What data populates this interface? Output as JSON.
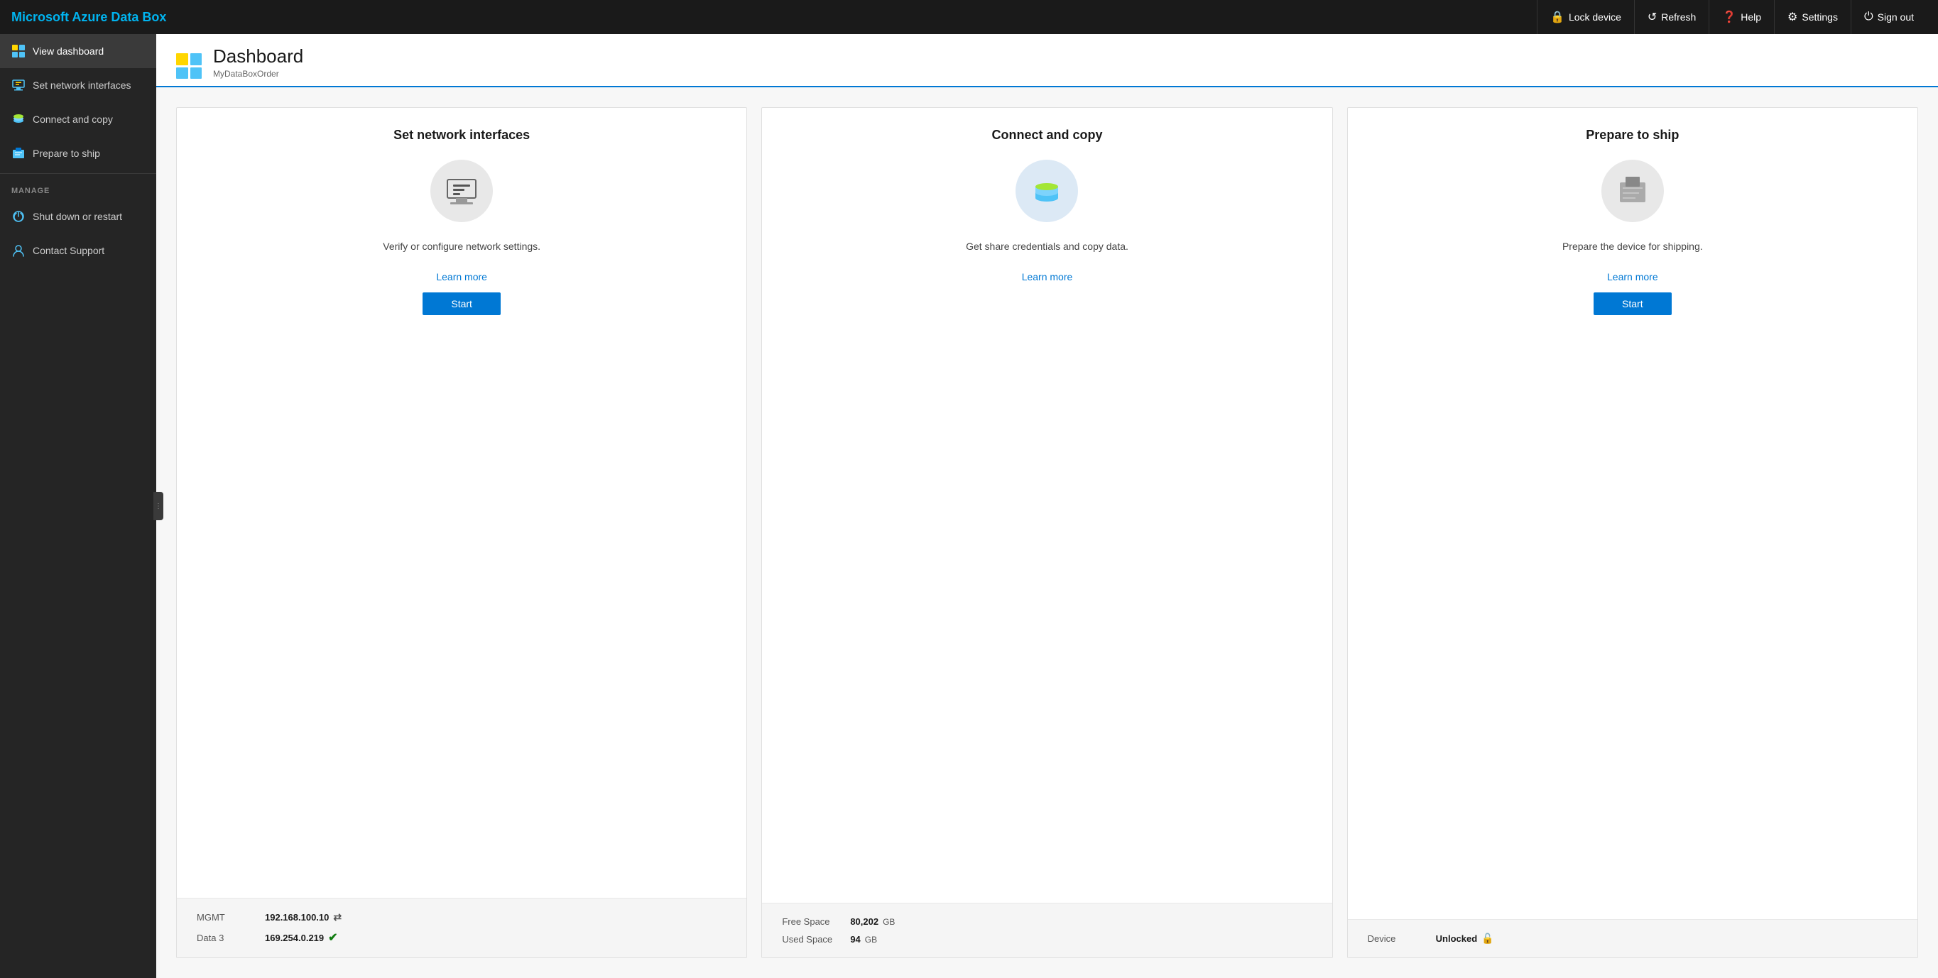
{
  "app": {
    "title": "Microsoft Azure Data Box"
  },
  "topnav": {
    "brand": "Microsoft Azure Data Box",
    "actions": [
      {
        "id": "lock-device",
        "label": "Lock device",
        "icon": "🔒"
      },
      {
        "id": "refresh",
        "label": "Refresh",
        "icon": "↺"
      },
      {
        "id": "help",
        "label": "Help",
        "icon": "❓"
      },
      {
        "id": "settings",
        "label": "Settings",
        "icon": "⚙"
      },
      {
        "id": "sign-out",
        "label": "Sign out",
        "icon": "⏻"
      }
    ]
  },
  "sidebar": {
    "nav_items": [
      {
        "id": "view-dashboard",
        "label": "View dashboard",
        "active": true
      },
      {
        "id": "set-network-interfaces",
        "label": "Set network interfaces",
        "active": false
      },
      {
        "id": "connect-and-copy",
        "label": "Connect and copy",
        "active": false
      },
      {
        "id": "prepare-to-ship",
        "label": "Prepare to ship",
        "active": false
      }
    ],
    "manage_section_label": "MANAGE",
    "manage_items": [
      {
        "id": "shut-down-or-restart",
        "label": "Shut down or restart"
      },
      {
        "id": "contact-support",
        "label": "Contact Support"
      }
    ]
  },
  "page": {
    "title": "Dashboard",
    "subtitle": "MyDataBoxOrder"
  },
  "cards": [
    {
      "id": "set-network-interfaces",
      "title": "Set network interfaces",
      "description": "Verify or configure network settings.",
      "learn_more_label": "Learn more",
      "start_label": "Start",
      "info_rows": [
        {
          "label": "MGMT",
          "value": "192.168.100.10",
          "extra": "⇄",
          "extra_type": "link"
        },
        {
          "label": "Data 3",
          "value": "169.254.0.219",
          "extra": "✔",
          "extra_type": "ok"
        }
      ]
    },
    {
      "id": "connect-and-copy",
      "title": "Connect and copy",
      "description": "Get share credentials and copy data.",
      "learn_more_label": "Learn more",
      "start_label": null,
      "info_rows": [
        {
          "label": "Free Space",
          "value": "80,202",
          "unit": "GB",
          "extra": null
        },
        {
          "label": "Used Space",
          "value": "94",
          "unit": "GB",
          "extra": null
        }
      ]
    },
    {
      "id": "prepare-to-ship",
      "title": "Prepare to ship",
      "description": "Prepare the device for shipping.",
      "learn_more_label": "Learn more",
      "start_label": "Start",
      "info_rows": [
        {
          "label": "Device",
          "value": "Unlocked",
          "extra": "🔓",
          "extra_type": "unlock"
        }
      ]
    }
  ]
}
